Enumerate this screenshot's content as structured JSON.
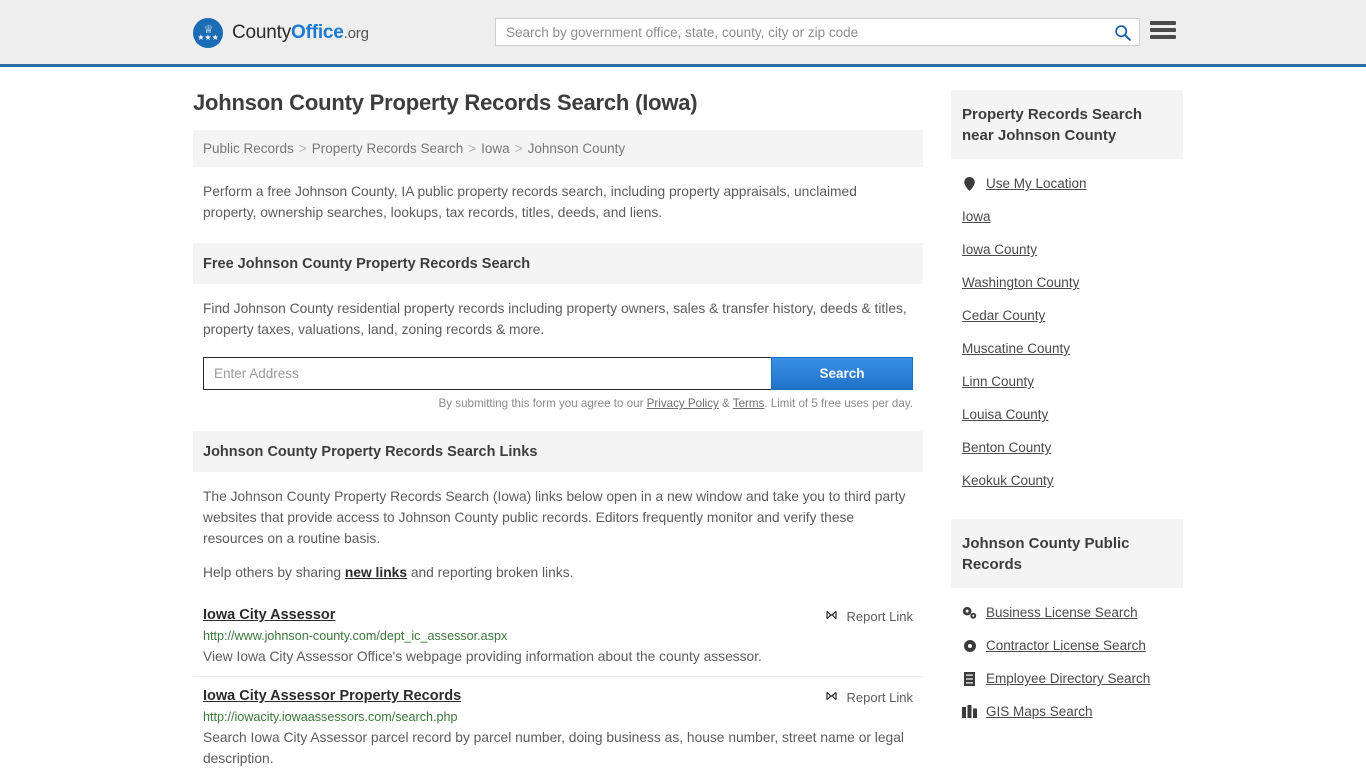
{
  "header": {
    "brand": {
      "part1": "County",
      "part2": "Office",
      "part3": ".org"
    },
    "search": {
      "placeholder": "Search by government office, state, county, city or zip code",
      "value": ""
    },
    "menu_label": "Menu"
  },
  "page": {
    "title": "Johnson County Property Records Search (Iowa)",
    "breadcrumb": [
      "Public Records",
      "Property Records Search",
      "Iowa",
      "Johnson County"
    ],
    "breadcrumb_separator": ">",
    "intro": "Perform a free Johnson County, IA public property records search, including property appraisals, unclaimed property, ownership searches, lookups, tax records, titles, deeds, and liens."
  },
  "free_search": {
    "heading": "Free Johnson County Property Records Search",
    "description": "Find Johnson County residential property records including property owners, sales & transfer history, deeds & titles, property taxes, valuations, land, zoning records & more.",
    "input_placeholder": "Enter Address",
    "input_value": "",
    "button_label": "Search",
    "disclaimer_pre": "By submitting this form you agree to our ",
    "disclaimer_privacy": "Privacy Policy",
    "disclaimer_amp": " & ",
    "disclaimer_terms": "Terms",
    "disclaimer_post": ". Limit of 5 free uses per day."
  },
  "links_section": {
    "heading": "Johnson County Property Records Search Links",
    "description": "The Johnson County Property Records Search (Iowa) links below open in a new window and take you to third party websites that provide access to Johnson County public records. Editors frequently monitor and verify these resources on a routine basis.",
    "help_pre": "Help others by sharing ",
    "help_link": "new links",
    "help_post": " and reporting broken links.",
    "report_label": "Report Link",
    "results": [
      {
        "title": "Iowa City Assessor",
        "url": "http://www.johnson-county.com/dept_ic_assessor.aspx",
        "description": "View Iowa City Assessor Office's webpage providing information about the county assessor."
      },
      {
        "title": "Iowa City Assessor Property Records",
        "url": "http://iowacity.iowaassessors.com/search.php",
        "description": "Search Iowa City Assessor parcel record by parcel number, doing business as, house number, street name or legal description."
      }
    ]
  },
  "sidebar": {
    "nearby": {
      "heading": "Property Records Search near Johnson County",
      "items": [
        {
          "label": "Use My Location",
          "icon": "map-pin-icon"
        },
        {
          "label": "Iowa",
          "icon": ""
        },
        {
          "label": "Iowa County",
          "icon": ""
        },
        {
          "label": "Washington County",
          "icon": ""
        },
        {
          "label": "Cedar County",
          "icon": ""
        },
        {
          "label": "Muscatine County",
          "icon": ""
        },
        {
          "label": "Linn County",
          "icon": ""
        },
        {
          "label": "Louisa County",
          "icon": ""
        },
        {
          "label": "Benton County",
          "icon": ""
        },
        {
          "label": "Keokuk County",
          "icon": ""
        }
      ]
    },
    "public_records": {
      "heading": "Johnson County Public Records",
      "items": [
        {
          "label": "Business License Search",
          "icon": "cogs-icon"
        },
        {
          "label": "Contractor License Search",
          "icon": "gear-icon"
        },
        {
          "label": "Employee Directory Search",
          "icon": "id-card-icon"
        },
        {
          "label": "GIS Maps Search",
          "icon": "map-chart-icon"
        }
      ]
    }
  },
  "colors": {
    "header_bg": "#eeeeee",
    "header_border": "#2f6ea5",
    "brand_blue": "#1b7ad1",
    "button_blue": "#2f80d8",
    "url_green": "#3c763d",
    "panel_gray": "#f4f4f4"
  }
}
